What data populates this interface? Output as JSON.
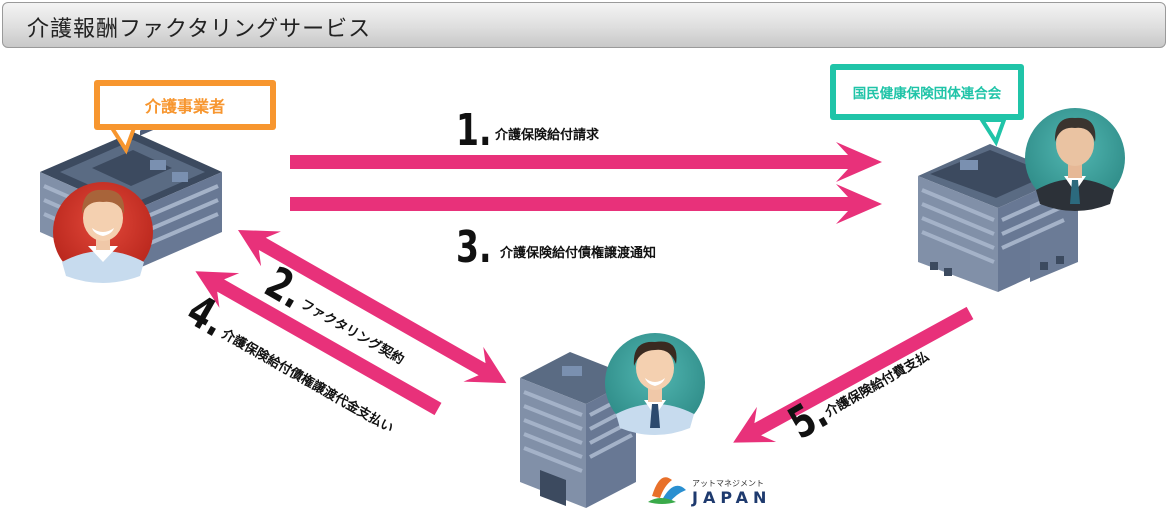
{
  "title": "介護報酬ファクタリングサービス",
  "nodes": {
    "provider": {
      "label": "介護事業者",
      "color": "#f7962f"
    },
    "federation": {
      "label": "国民健康保険団体連合会",
      "color": "#20c4a8"
    }
  },
  "steps": [
    {
      "number": "1.",
      "label": "介護保険給付請求"
    },
    {
      "number": "2.",
      "label": "ファクタリング契約"
    },
    {
      "number": "3.",
      "label": "介護保険給付債権譲渡通知"
    },
    {
      "number": "4.",
      "label": "介護保険給付債権譲渡代金支払い"
    },
    {
      "number": "5.",
      "label": "介護保険給付費支払"
    }
  ],
  "logo": {
    "kana": "アットマネジメント",
    "name": "JAPAN"
  },
  "colors": {
    "arrow": "#e8317a",
    "building": "#7d8ea7"
  }
}
